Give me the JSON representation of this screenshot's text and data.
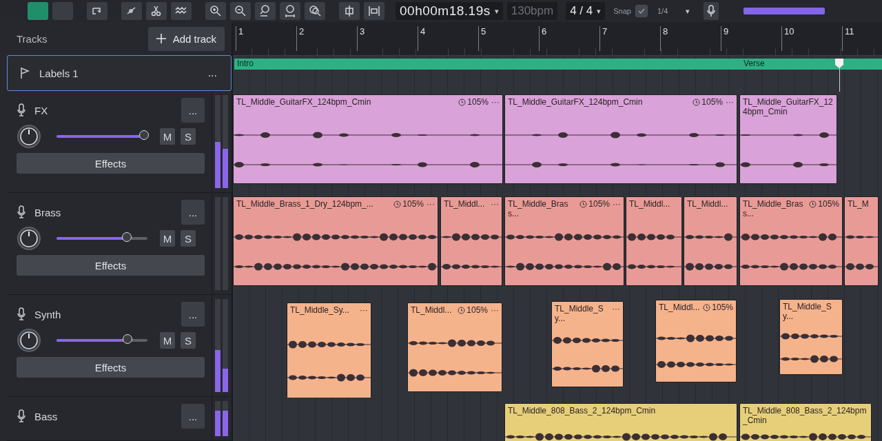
{
  "toolbar": {
    "time": "00h00m18.19s",
    "time_caret": "▾",
    "tempo": "130bpm",
    "signature": "4 / 4",
    "signature_caret": "▾",
    "snap_label": "Snap",
    "snap_checked": true,
    "grid": "1/4",
    "grid_caret": "▾"
  },
  "tracks_panel": {
    "title": "Tracks",
    "add_button": "Add track"
  },
  "ruler": {
    "bars": [
      "1",
      "2",
      "3",
      "4",
      "5",
      "6",
      "7",
      "8",
      "9",
      "10",
      "11"
    ]
  },
  "label_track": {
    "name": "Labels 1",
    "menu": "...",
    "markers": [
      {
        "text": "Intro"
      },
      {
        "text": "Verse"
      }
    ]
  },
  "tracks": [
    {
      "name": "FX",
      "color": "#d9a2d8",
      "level": 0.97,
      "mute": "M",
      "solo": "S",
      "effects": "Effects",
      "menu": "...",
      "meter": [
        {
          "level": 0.5
        },
        {
          "level": 0.42
        }
      ],
      "clips": [
        {
          "title": "TL_Middle_GuitarFX_124bpm_Cmin",
          "stretch": "105%",
          "menu": "···"
        },
        {
          "title": "TL_Middle_GuitarFX_124bpm_Cmin",
          "stretch": "105%",
          "menu": "···"
        },
        {
          "title": "TL_Middle_GuitarFX_124bpm_Cmin"
        }
      ]
    },
    {
      "name": "Brass",
      "color": "#e89b96",
      "level": 0.78,
      "mute": "M",
      "solo": "S",
      "effects": "Effects",
      "menu": "...",
      "meter": [
        {
          "level": 0
        },
        {
          "level": 0
        }
      ],
      "clips": [
        {
          "title": "TL_Middle_Brass_1_Dry_124bpm_...",
          "stretch": "105%",
          "menu": "···"
        },
        {
          "title": "TL_Middl...",
          "menu": "···"
        },
        {
          "title": "TL_Middle_Brass...",
          "stretch": "105%",
          "menu": "···"
        },
        {
          "title": "TL_Middl..."
        },
        {
          "title": "TL_Middl..."
        },
        {
          "title": "TL_Middle_Brass...",
          "stretch": "105%"
        },
        {
          "title": "TL_M"
        }
      ]
    },
    {
      "name": "Synth",
      "color": "#f5b38c",
      "level": 0.79,
      "mute": "M",
      "solo": "S",
      "effects": "Effects",
      "menu": "...",
      "meter": [
        {
          "level": 0.45
        },
        {
          "level": 0.25
        }
      ],
      "clips": [
        {
          "title": "TL_Middle_Sy...",
          "menu": "···"
        },
        {
          "title": "TL_Middl...",
          "stretch": "105%",
          "menu": "···"
        },
        {
          "title": "TL_Middle_Sy...",
          "menu": "···"
        },
        {
          "title": "TL_Middl...",
          "stretch": "105%"
        },
        {
          "title": "TL_Middle_Sy..."
        }
      ]
    },
    {
      "name": "Bass",
      "color": "#e6cf78",
      "menu": "...",
      "meter": [
        {
          "level": 0.72
        },
        {
          "level": 0.72
        }
      ],
      "clips": [
        {
          "title": "TL_Middle_808_Bass_2_124bpm_Cmin"
        },
        {
          "title": "TL_Middle_808_Bass_2_124bpm_Cmin"
        }
      ]
    }
  ]
}
